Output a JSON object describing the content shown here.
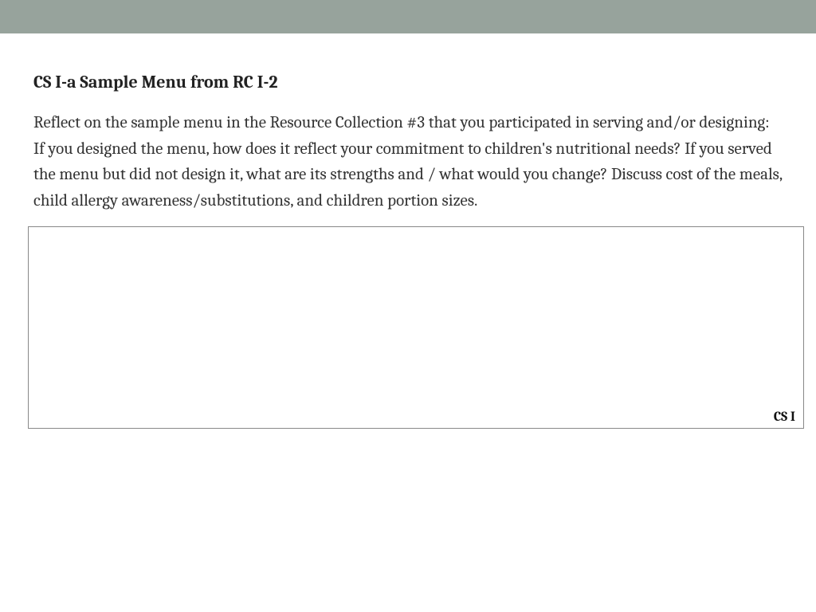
{
  "header": {},
  "content": {
    "heading": "CS I-a Sample Menu from RC I-2",
    "body": "Reflect on the sample menu in the Resource Collection #3 that you participated in serving and/or designing: If you designed the menu, how does it reflect your commitment to children's nutritional needs?  If you served the menu but did not design it, what are its strengths and / what would you change? Discuss cost of the meals, child allergy awareness/substitutions, and children portion sizes."
  },
  "response_box": {
    "label": "CS I",
    "value": ""
  }
}
